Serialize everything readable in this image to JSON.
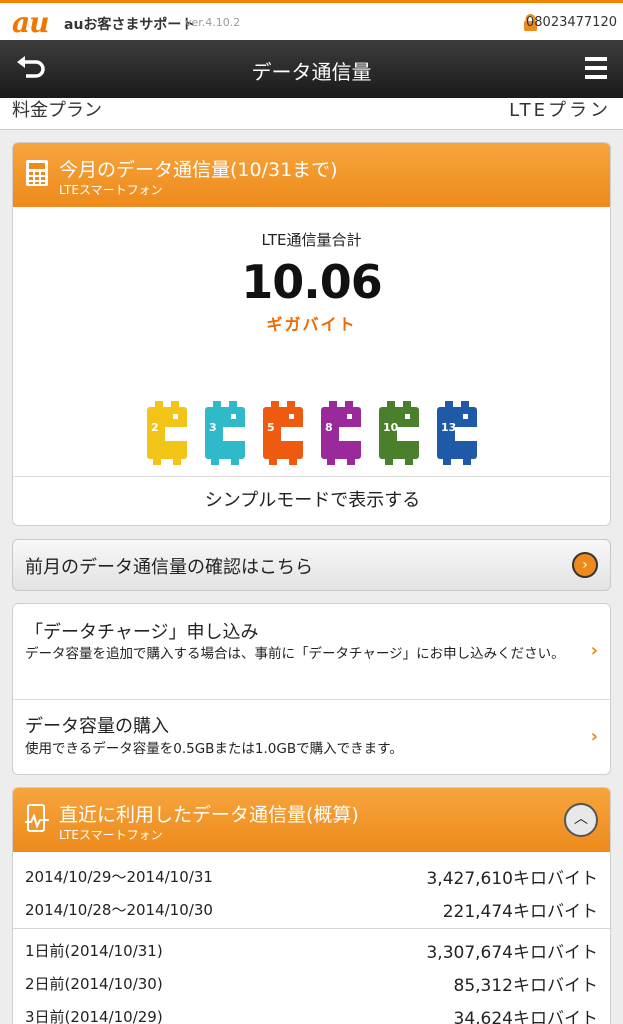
{
  "brand": {
    "logo": "au",
    "name": "auお客さまサポート",
    "version": "ver.4.10.2",
    "phone": "08023477120"
  },
  "nav": {
    "title": "データ通信量"
  },
  "plan": {
    "label": "料金プラン",
    "value": "LTEプラン"
  },
  "monthly": {
    "title": "今月のデータ通信量(10/31まで)",
    "subtitle": "LTEスマートフォン",
    "usage_label": "LTE通信量合計",
    "usage_value": "10.06",
    "usage_unit": "ギガバイト",
    "characters": [
      {
        "num": "2",
        "color": "#f2c418"
      },
      {
        "num": "3",
        "color": "#2fb9c9"
      },
      {
        "num": "5",
        "color": "#ee5a10"
      },
      {
        "num": "8",
        "color": "#9a2a9c"
      },
      {
        "num": "10",
        "color": "#4a7f2c"
      },
      {
        "num": "13",
        "color": "#1e5aa8"
      }
    ],
    "simple_mode": "シンプルモードで表示する"
  },
  "prev_month": {
    "label": "前月のデータ通信量の確認はこちら"
  },
  "menu": [
    {
      "title": "「データチャージ」申し込み",
      "desc": "データ容量を追加で購入する場合は、事前に「データチャージ」にお申し込みください。"
    },
    {
      "title": "データ容量の購入",
      "desc": "使用できるデータ容量を0.5GBまたは1.0GBで購入できます。"
    }
  ],
  "recent": {
    "title": "直近に利用したデータ通信量(概算)",
    "subtitle": "LTEスマートフォン",
    "period_rows": [
      {
        "date": "2014/10/29～2014/10/31",
        "value": "3,427,610キロバイト"
      },
      {
        "date": "2014/10/28～2014/10/30",
        "value": "221,474キロバイト"
      }
    ],
    "daily_rows": [
      {
        "date": "1日前(2014/10/31)",
        "value": "3,307,674キロバイト"
      },
      {
        "date": "2日前(2014/10/30)",
        "value": "85,312キロバイト"
      },
      {
        "date": "3日前(2014/10/29)",
        "value": "34,624キロバイト"
      }
    ]
  },
  "colors": {
    "accent": "#ee8a1b",
    "nav": "#2a2a2a"
  }
}
